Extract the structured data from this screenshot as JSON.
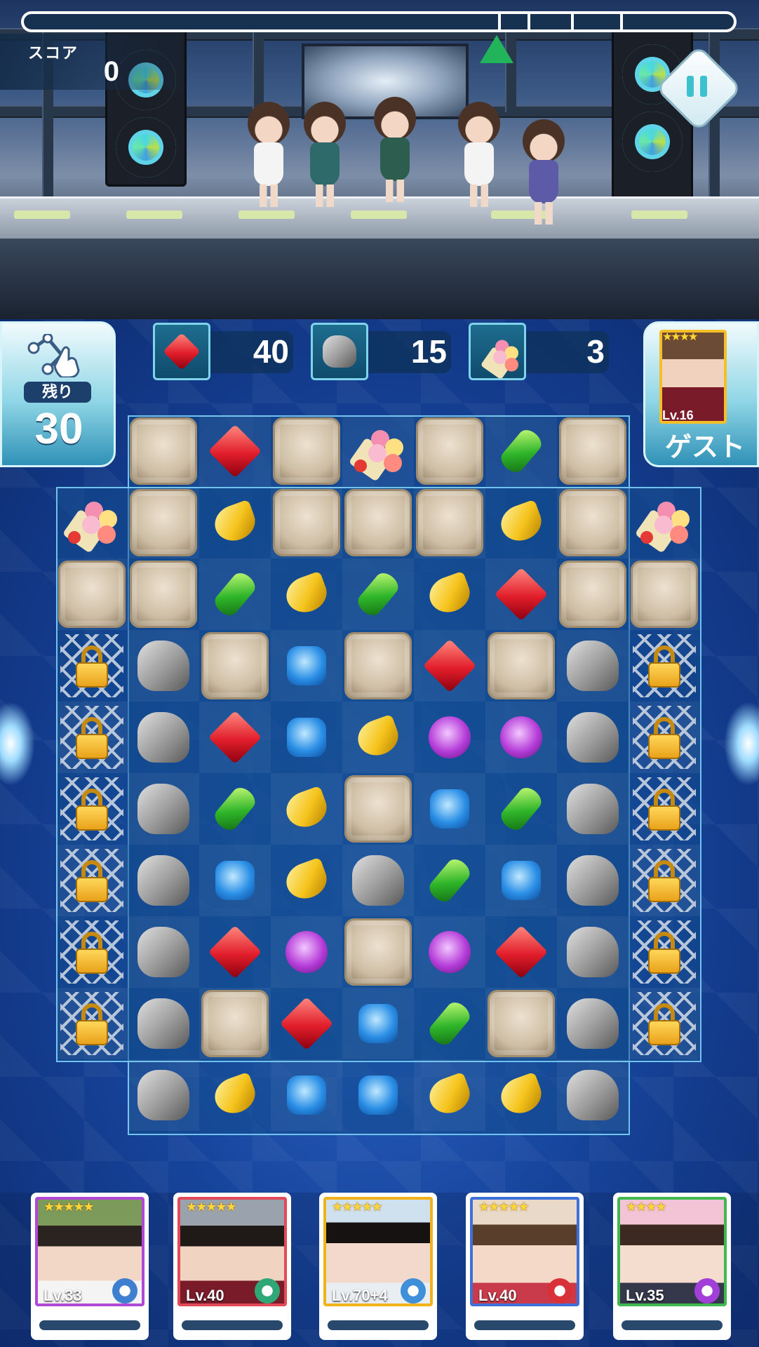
{
  "hud": {
    "score_label": "スコア",
    "score_value": "0",
    "score_progress": 0
  },
  "moves": {
    "label": "残り",
    "value": "30"
  },
  "goals": [
    {
      "item": "red-gem",
      "count": "40"
    },
    {
      "item": "rock",
      "count": "15"
    },
    {
      "item": "bouquet",
      "count": "3"
    }
  ],
  "guest": {
    "name": "ゲスト",
    "level": "Lv.16",
    "stars": 4
  },
  "board": {
    "columns": 9,
    "rows": 10,
    "cells": [
      [
        null,
        "block",
        "red",
        "block",
        "bouquet",
        "block",
        "green",
        "block",
        null
      ],
      [
        "bouquet",
        "block",
        "yellow",
        "block",
        "block",
        "block",
        "yellow",
        "block",
        "bouquet"
      ],
      [
        "block",
        "block",
        "green",
        "yellow",
        "green",
        "yellow",
        "red",
        "block",
        "block"
      ],
      [
        "lock",
        "rock",
        "block",
        "blue",
        "block",
        "red",
        "block",
        "rock",
        "lock"
      ],
      [
        "lock",
        "rock",
        "red",
        "blue",
        "yellow",
        "purple",
        "purple",
        "rock",
        "lock"
      ],
      [
        "lock",
        "rock",
        "green",
        "yellow",
        "block",
        "blue",
        "green",
        "rock",
        "lock"
      ],
      [
        "lock",
        "rock",
        "blue",
        "yellow",
        "rock",
        "green",
        "blue",
        "rock",
        "lock"
      ],
      [
        "lock",
        "rock",
        "red",
        "purple",
        "block",
        "purple",
        "red",
        "rock",
        "lock"
      ],
      [
        "lock",
        "rock",
        "block",
        "red",
        "blue",
        "green",
        "block",
        "rock",
        "lock"
      ],
      [
        null,
        "rock",
        "yellow",
        "blue",
        "blue",
        "yellow",
        "yellow",
        "rock",
        null
      ]
    ]
  },
  "members": [
    {
      "level": "Lv.33",
      "stars": "★★★★★",
      "frame_color": "#b04ad6",
      "skill_color": "#3f7fcf"
    },
    {
      "level": "Lv.40",
      "stars": "★★★★★",
      "frame_color": "#e24a57",
      "skill_color": "#2fa776"
    },
    {
      "level": "Lv.70+4",
      "stars": "★★★★★",
      "frame_color": "#f2b21b",
      "skill_color": "#3f8fd9"
    },
    {
      "level": "Lv.40",
      "stars": "★★★★★",
      "frame_color": "#3f6fd9",
      "skill_color": "#d9313a"
    },
    {
      "level": "Lv.35",
      "stars": "★★★★",
      "frame_color": "#3fb94f",
      "skill_color": "#a33fd9"
    }
  ],
  "colors": {
    "accent_cyan": "#7fd3ea",
    "board_blue": "#16439a",
    "progress_marker": "#21b45a"
  }
}
